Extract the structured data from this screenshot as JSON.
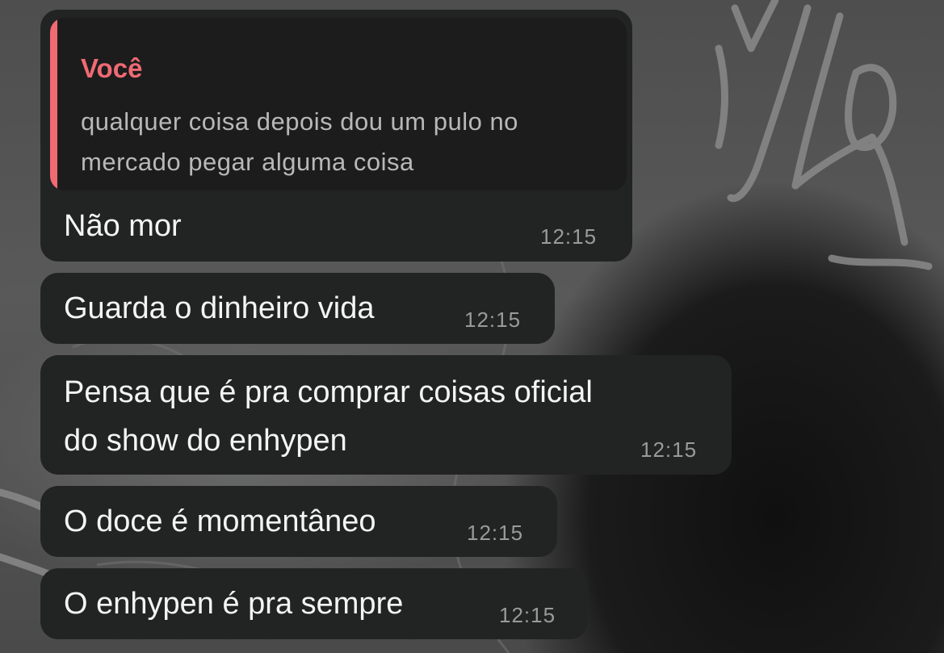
{
  "reply": {
    "author": "Você",
    "text": "qualquer coisa depois dou um pulo no mercado pegar alguma coisa"
  },
  "messages": [
    {
      "text": "Não mor",
      "time": "12:15"
    },
    {
      "text": "Guarda o dinheiro vida",
      "time": "12:15"
    },
    {
      "text_line1": "Pensa que é pra comprar coisas oficial",
      "text_line2": "do show do enhypen",
      "time": "12:15"
    },
    {
      "text": "O doce é momentâneo",
      "time": "12:15"
    },
    {
      "text": "O enhypen é pra sempre",
      "time": "12:15"
    }
  ],
  "colors": {
    "bubble": "#222323",
    "reply_accent": "#f06a73",
    "timestamp": "#9a9a9a"
  }
}
